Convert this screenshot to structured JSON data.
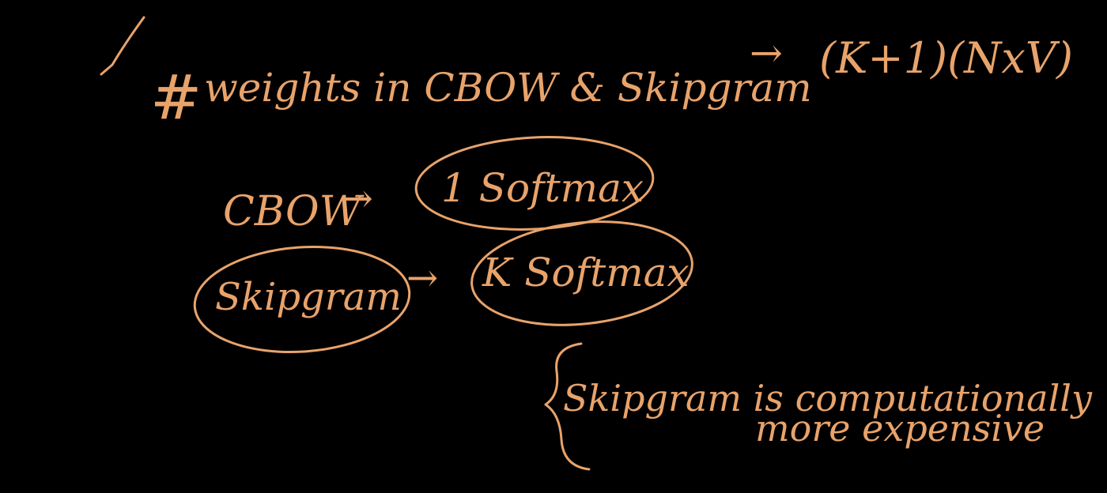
{
  "board": {
    "background": "#000000",
    "ink_color": "#E8A36B",
    "checkmark_icon": "check-mark",
    "heading": {
      "hash": "#",
      "text": "weights in CBOW & Skipgram",
      "arrow": "→",
      "formula": "(K+1)(NxV)"
    },
    "cbow_row": {
      "label": "CBOW",
      "arrow": "→",
      "result": "1 Softmax"
    },
    "skipgram_row": {
      "label": "Skipgram",
      "arrow": "→",
      "result": "K Softmax"
    },
    "note": {
      "line1": "Skipgram is computationally",
      "line2": "more expensive"
    }
  }
}
